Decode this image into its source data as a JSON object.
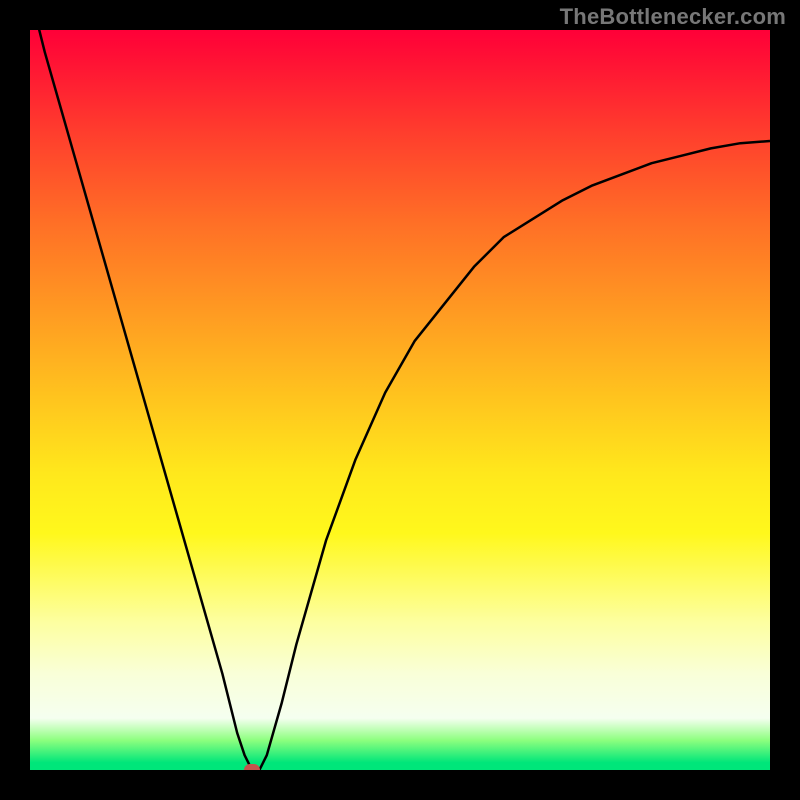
{
  "watermark": "TheBottlenecker.com",
  "chart_data": {
    "type": "line",
    "title": "",
    "xlabel": "",
    "ylabel": "",
    "xlim": [
      0,
      100
    ],
    "ylim": [
      0,
      100
    ],
    "series": [
      {
        "name": "bottleneck-curve",
        "x": [
          0,
          2,
          4,
          6,
          8,
          10,
          12,
          14,
          16,
          18,
          20,
          22,
          24,
          26,
          27,
          28,
          29,
          30,
          31,
          32,
          34,
          36,
          38,
          40,
          44,
          48,
          52,
          56,
          60,
          64,
          68,
          72,
          76,
          80,
          84,
          88,
          92,
          96,
          100
        ],
        "y": [
          105,
          97,
          90,
          83,
          76,
          69,
          62,
          55,
          48,
          41,
          34,
          27,
          20,
          13,
          9,
          5,
          2,
          0,
          0,
          2,
          9,
          17,
          24,
          31,
          42,
          51,
          58,
          63,
          68,
          72,
          74.5,
          77,
          79,
          80.5,
          82,
          83,
          84,
          84.7,
          85
        ]
      }
    ],
    "marker": {
      "x": 30,
      "y": 0,
      "color": "#c6524d"
    },
    "gradient_stops": [
      {
        "pos": 0,
        "color": "#ff0038"
      },
      {
        "pos": 50,
        "color": "#ffe81c"
      },
      {
        "pos": 95,
        "color": "#f5fff0"
      },
      {
        "pos": 100,
        "color": "#00e67a"
      }
    ]
  }
}
